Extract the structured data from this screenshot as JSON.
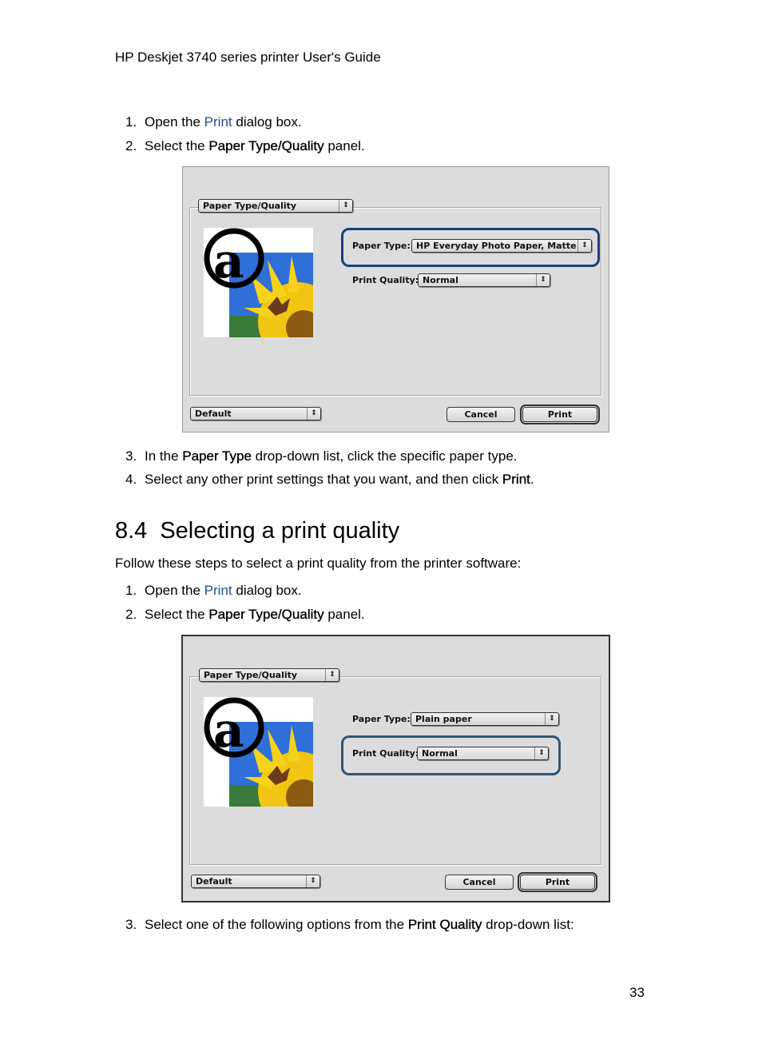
{
  "header": {
    "running_title": "HP Deskjet 3740 series printer User's Guide"
  },
  "section_a": {
    "steps": [
      {
        "num": "1.",
        "pre": "Open the ",
        "link": "Print",
        "post": " dialog box."
      },
      {
        "num": "2.",
        "pre": "Select the ",
        "bold": "Paper Type/Quality",
        "post": " panel."
      },
      {
        "num": "3.",
        "pre": "In the ",
        "bold": "Paper Type",
        "post": " drop-down list, click the specific paper type."
      },
      {
        "num": "4.",
        "pre": "Select any other print settings that you want, and then click ",
        "bold": "Print",
        "post": "."
      }
    ]
  },
  "dialog1": {
    "panel_popup": "Paper Type/Quality",
    "paper_type_label": "Paper Type:",
    "paper_type_value": "HP Everyday Photo Paper, Matte",
    "print_quality_label": "Print Quality:",
    "print_quality_value": "Normal",
    "preset_popup": "Default",
    "cancel_label": "Cancel",
    "print_label": "Print",
    "highlighted": "paper-type"
  },
  "section_b": {
    "number": "8.4",
    "title": "Selecting a print quality",
    "intro": "Follow these steps to select a print quality from the printer software:",
    "steps": [
      {
        "num": "1.",
        "pre": "Open the ",
        "link": "Print",
        "post": " dialog box."
      },
      {
        "num": "2.",
        "pre": "Select the ",
        "bold": "Paper Type/Quality",
        "post": " panel."
      },
      {
        "num": "3.",
        "pre": "Select one of the following options from the ",
        "bold": "Print Quality",
        "post": " drop-down list:"
      }
    ]
  },
  "dialog2": {
    "panel_popup": "Paper Type/Quality",
    "paper_type_label": "Paper Type:",
    "paper_type_value": "Plain paper",
    "print_quality_label": "Print Quality:",
    "print_quality_value": "Normal",
    "preset_popup": "Default",
    "cancel_label": "Cancel",
    "print_label": "Print",
    "highlighted": "print-quality"
  },
  "icons": {
    "popup_arrows": "⇕"
  },
  "colors": {
    "link": "#1f4f8f",
    "highlight_ring": "#1d3f7c",
    "dialog_bg": "#dcdcdc"
  },
  "footer": {
    "page_number": "33"
  }
}
